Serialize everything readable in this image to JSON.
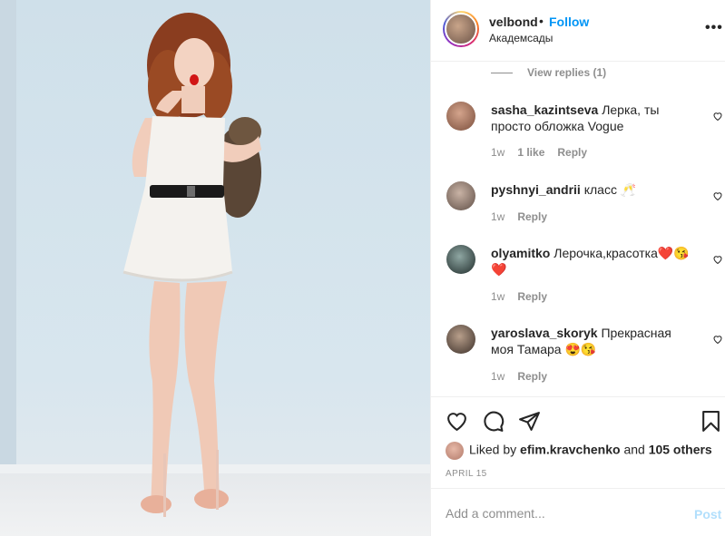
{
  "post": {
    "username": "velbond",
    "separator": "•",
    "follow_label": "Follow",
    "location": "Академсады",
    "more_label": "•••"
  },
  "view_replies": "View replies (1)",
  "comments": [
    {
      "user": "sasha_kazintseva",
      "text": "Лерка, ты просто обложка Vogue",
      "time": "1w",
      "likes": "1 like",
      "reply": "Reply"
    },
    {
      "user": "pyshnyi_andrii",
      "text": "класс 🥂",
      "time": "1w",
      "reply": "Reply"
    },
    {
      "user": "olyamitko",
      "text": "Лерочка,красотка❤️😘❤️",
      "time": "1w",
      "reply": "Reply"
    },
    {
      "user": "yaroslava_skoryk",
      "text": "Прекрасная моя Тамара 😍😘",
      "time": "1w",
      "reply": "Reply"
    }
  ],
  "liked_by": {
    "prefix": "Liked by",
    "user": "efim.kravchenko",
    "and": "and",
    "others": "105 others"
  },
  "date": "APRIL 15",
  "add_comment": {
    "placeholder": "Add a comment...",
    "post_label": "Post"
  },
  "colors": {
    "accent": "#0095f6",
    "post_disabled": "#b2dffc",
    "muted": "#8e8e8e"
  }
}
